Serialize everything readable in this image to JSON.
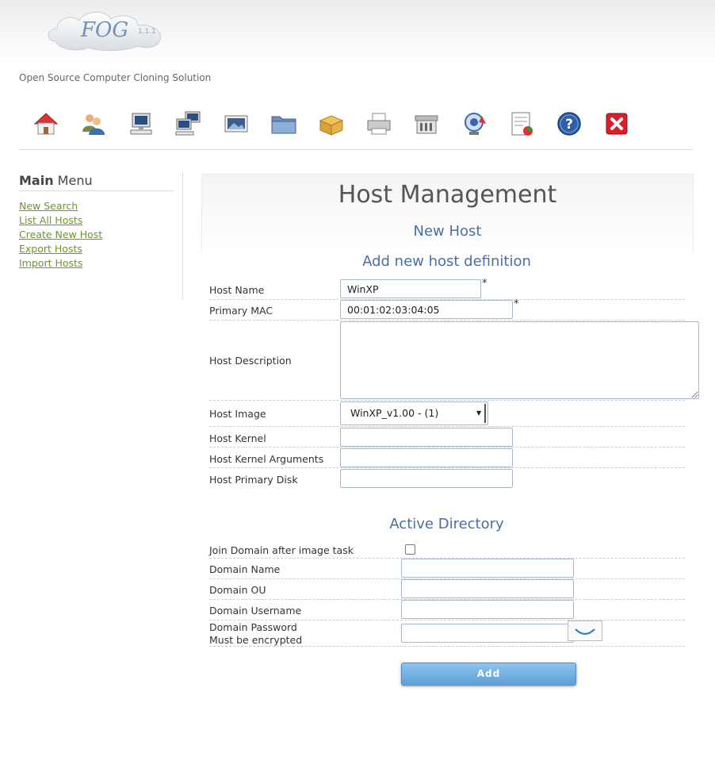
{
  "header": {
    "logo_text": "FOG",
    "version": "1.1.1",
    "tagline": "Open Source Computer Cloning Solution"
  },
  "toolbar": {
    "icons": [
      "home-icon",
      "users-icon",
      "computer-icon",
      "computer-group-icon",
      "image-icon",
      "storage-icon",
      "snapin-icon",
      "printer-icon",
      "service-icon",
      "tasks-icon",
      "report-icon",
      "help-icon",
      "logout-icon"
    ]
  },
  "sidebar": {
    "title_bold": "Main",
    "title_rest": " Menu",
    "items": [
      {
        "label": "New Search"
      },
      {
        "label": "List All Hosts"
      },
      {
        "label": "Create New Host"
      },
      {
        "label": "Export Hosts"
      },
      {
        "label": "Import Hosts"
      }
    ]
  },
  "main": {
    "title": "Host Management",
    "subtitle": "New Host",
    "section_title": "Add new host definition",
    "fields": {
      "host_name": {
        "label": "Host Name",
        "value": "WinXP"
      },
      "primary_mac": {
        "label": "Primary MAC",
        "value": "00:01:02:03:04:05"
      },
      "host_description": {
        "label": "Host Description",
        "value": ""
      },
      "host_image": {
        "label": "Host Image",
        "value": "WinXP_v1.00 - (1)"
      },
      "host_kernel": {
        "label": "Host Kernel",
        "value": ""
      },
      "host_kernel_args": {
        "label": "Host Kernel Arguments",
        "value": ""
      },
      "host_primary_disk": {
        "label": "Host Primary Disk",
        "value": ""
      }
    },
    "required_mark": "*"
  },
  "ad": {
    "section_title": "Active Directory",
    "join_domain": {
      "label": "Join Domain after image task",
      "checked": false
    },
    "domain_name": {
      "label": "Domain Name",
      "value": ""
    },
    "domain_ou": {
      "label": "Domain OU",
      "value": ""
    },
    "domain_username": {
      "label": "Domain Username",
      "value": ""
    },
    "domain_password": {
      "label_line1": "Domain Password",
      "label_line2": "Must be encrypted",
      "value": ""
    }
  },
  "actions": {
    "add_label": "Add"
  },
  "colors": {
    "link": "#6a9a1f",
    "section": "#4a6fa5",
    "button": "#5e9fd6"
  }
}
